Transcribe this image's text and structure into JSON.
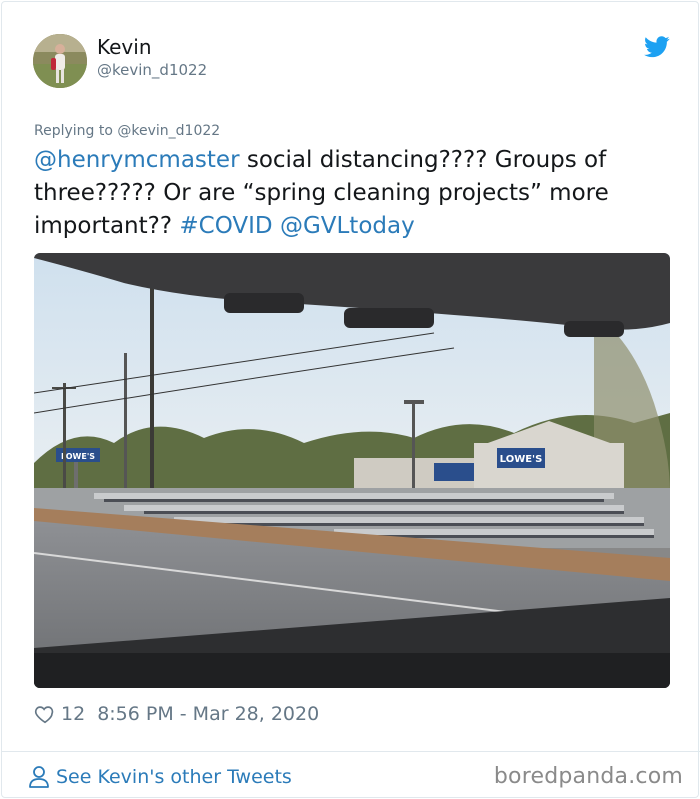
{
  "tweet": {
    "author": {
      "display_name": "Kevin",
      "handle": "@kevin_d1022",
      "avatar": "profile-photo"
    },
    "brand_icon": "twitter-bird-icon",
    "reply_to": "Replying to @kevin_d1022",
    "text_parts": {
      "mention_1": "@henrymcmaster",
      "body": " social distancing???? Groups of three????? Or are “spring cleaning projects” more important?? ",
      "hashtag": "#COVID",
      "space": " ",
      "mention_2": "@GVLtoday"
    },
    "media": {
      "description_icon": "photo-parking-lot",
      "store_sign_1": "LOWE'S",
      "store_sign_2": "LOWE'S"
    },
    "likes": "12",
    "timestamp": "8:56 PM - Mar 28, 2020"
  },
  "footer": {
    "other_tweets_label": "See Kevin's other Tweets",
    "watermark": "boredpanda.com"
  },
  "colors": {
    "link": "#2b7bb9",
    "text": "#14171a",
    "muted": "#657786",
    "border": "#e1e8ed",
    "twitter_blue": "#1da1f2"
  }
}
